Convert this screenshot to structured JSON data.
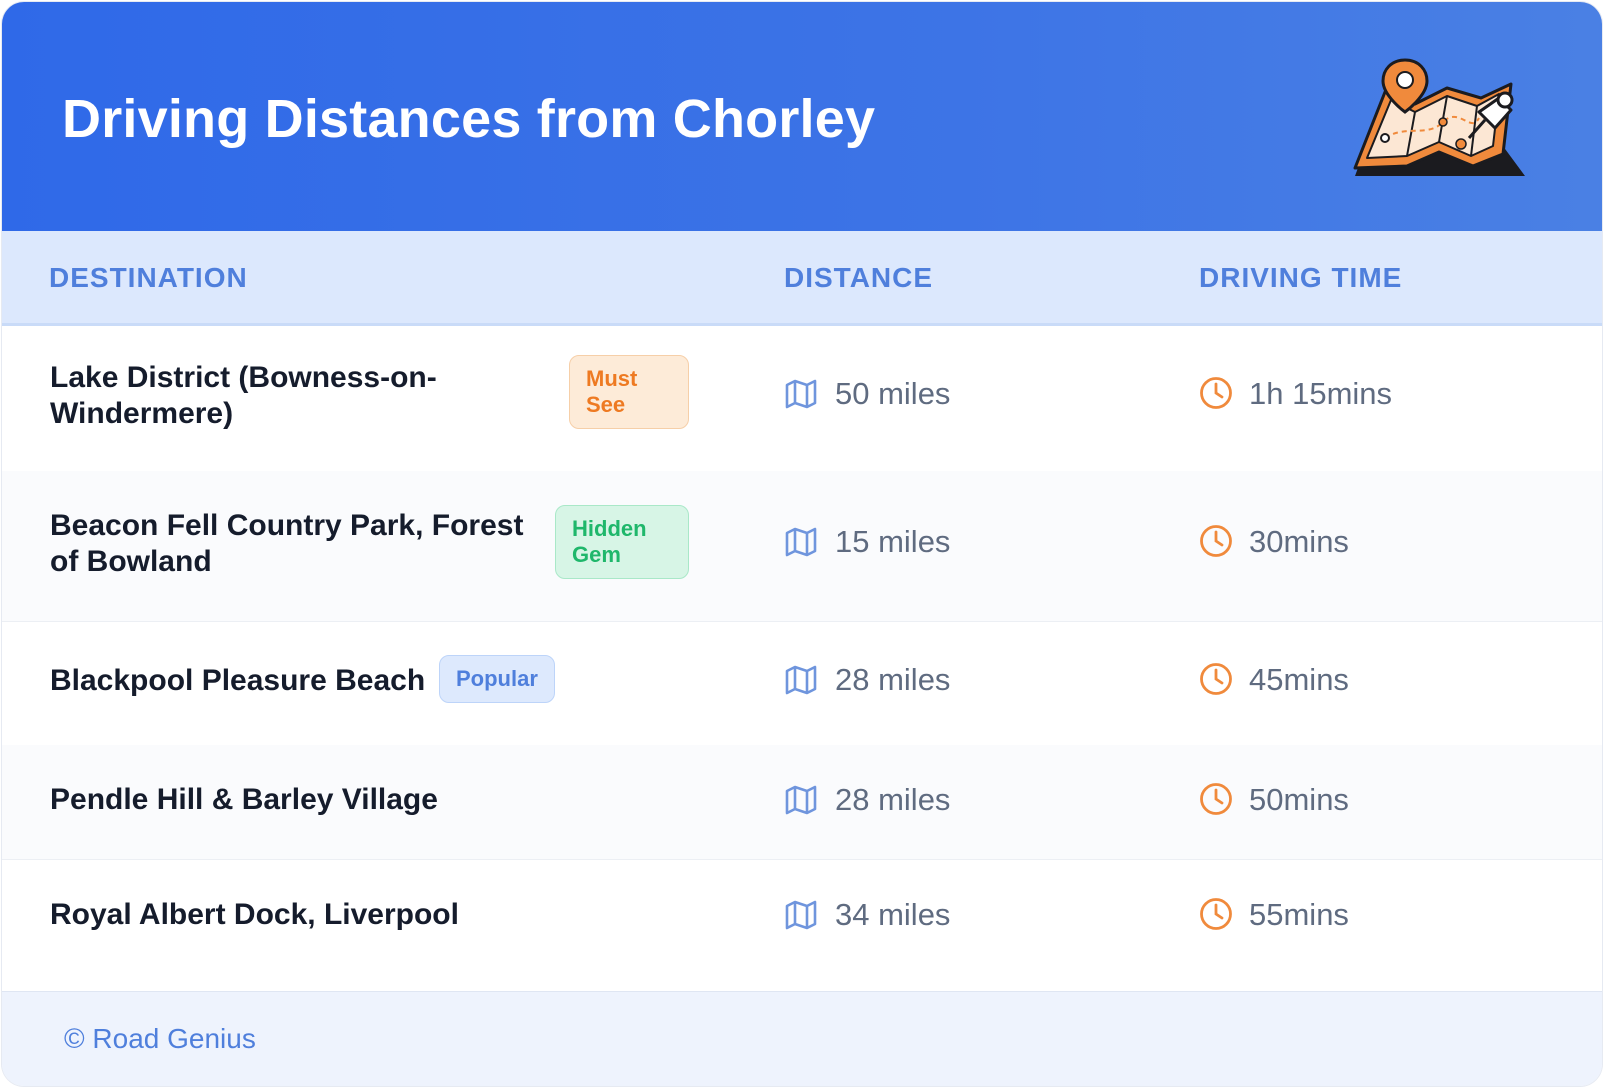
{
  "header": {
    "title": "Driving Distances from Chorley",
    "illustration_icon": "map-with-location-pin-icon"
  },
  "table": {
    "columns": [
      "DESTINATION",
      "DISTANCE",
      "DRIVING TIME"
    ],
    "rows": [
      {
        "destination": "Lake District (Bowness-on-Windermere)",
        "badge": "Must See",
        "badge_color": "orange",
        "distance": "50 miles",
        "time": "1h 15mins"
      },
      {
        "destination": "Beacon Fell Country Park, Forest of Bowland",
        "badge": "Hidden Gem",
        "badge_color": "green",
        "distance": "15 miles",
        "time": "30mins"
      },
      {
        "destination": "Blackpool Pleasure Beach",
        "badge": "Popular",
        "badge_color": "blue",
        "distance": "28 miles",
        "time": "45mins"
      },
      {
        "destination": "Pendle Hill & Barley Village",
        "badge": "",
        "distance": "28 miles",
        "time": "50mins"
      },
      {
        "destination": "Royal Albert Dock, Liverpool",
        "badge": "",
        "distance": "34 miles",
        "time": "55mins"
      }
    ],
    "distance_icon": "folded-map-icon",
    "time_icon": "clock-icon"
  },
  "footer": {
    "credit": "© Road Genius"
  },
  "colors": {
    "header_gradient_start": "#2f69e8",
    "header_gradient_end": "#4a80e4",
    "column_header_bg": "#dce8fd",
    "column_header_text": "#4f7fdc",
    "map_icon": "#6f95dd",
    "clock_icon": "#f08a3c",
    "badge_orange": "#ee7a22",
    "badge_green": "#1fb76b",
    "badge_blue": "#4f7fdc"
  }
}
